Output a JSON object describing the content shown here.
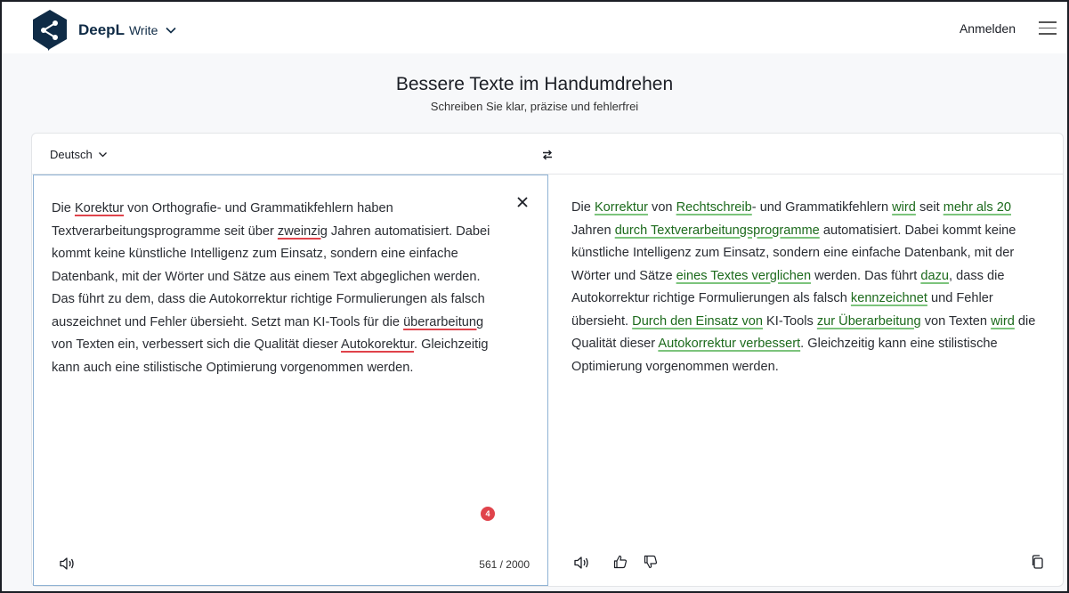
{
  "header": {
    "brand": "DeepL",
    "product": "Write",
    "login_label": "Anmelden",
    "icons": {
      "logo": "deepl-logo",
      "product_menu": "chevron-down-icon",
      "menu": "hamburger-menu-icon"
    }
  },
  "hero": {
    "title": "Bessere Texte im Handumdrehen",
    "subtitle": "Schreiben Sie klar, präzise und fehlerfrei"
  },
  "editor": {
    "language": "Deutsch",
    "input": {
      "segments": [
        {
          "t": "Die ",
          "s": "plain"
        },
        {
          "t": "Korektur",
          "s": "error"
        },
        {
          "t": " von Orthografie- und Grammatikfehlern haben Textverarbeitungsprogramme seit über ",
          "s": "plain"
        },
        {
          "t": "zweinzig",
          "s": "error"
        },
        {
          "t": " Jahren automatisiert. Dabei kommt keine künstliche Intelligenz zum Einsatz, sondern eine einfache Datenbank, mit der Wörter und Sätze aus einem Text abgeglichen werden. Das führt zu dem, dass die Autokorrektur richtige Formulierungen als falsch auszeichnet und Fehler übersieht. Setzt man KI-Tools für die ",
          "s": "plain"
        },
        {
          "t": "überarbeitung",
          "s": "error"
        },
        {
          "t": " von Texten ein, verbessert sich die Qualität dieser ",
          "s": "plain"
        },
        {
          "t": "Autokorektur",
          "s": "error"
        },
        {
          "t": ". Gleichzeitig kann auch eine stilistische Optimierung vorgenommen werden.",
          "s": "plain"
        }
      ],
      "error_count": "4",
      "char_counter": "561 / 2000"
    },
    "output": {
      "segments": [
        {
          "t": "Die ",
          "s": "plain"
        },
        {
          "t": "Korrektur",
          "s": "change"
        },
        {
          "t": " von ",
          "s": "plain"
        },
        {
          "t": "Rechtschreib",
          "s": "change"
        },
        {
          "t": "- und Grammatikfehlern ",
          "s": "plain"
        },
        {
          "t": "wird",
          "s": "change"
        },
        {
          "t": " seit ",
          "s": "plain"
        },
        {
          "t": "mehr als 20",
          "s": "change"
        },
        {
          "t": " Jahren ",
          "s": "plain"
        },
        {
          "t": "durch Textverarbeitungsprogramme",
          "s": "change"
        },
        {
          "t": " automatisiert. Dabei kommt keine künstliche Intelligenz zum Einsatz, sondern eine einfache Datenbank, mit der Wörter und Sätze ",
          "s": "plain"
        },
        {
          "t": "eines Textes verglichen",
          "s": "change"
        },
        {
          "t": " werden. Das führt ",
          "s": "plain"
        },
        {
          "t": "dazu",
          "s": "change"
        },
        {
          "t": ", dass die Autokorrektur richtige Formulierungen als falsch ",
          "s": "plain"
        },
        {
          "t": "kennzeichnet",
          "s": "change"
        },
        {
          "t": " und Fehler übersieht. ",
          "s": "plain"
        },
        {
          "t": "Durch den Einsatz von",
          "s": "change"
        },
        {
          "t": " KI-Tools ",
          "s": "plain"
        },
        {
          "t": "zur Überarbeitung",
          "s": "change"
        },
        {
          "t": " von Texten ",
          "s": "plain"
        },
        {
          "t": "wird",
          "s": "change"
        },
        {
          "t": " die Qualität dieser ",
          "s": "plain"
        },
        {
          "t": "Autokorrektur verbessert",
          "s": "change"
        },
        {
          "t": ". Gleichzeitig kann eine stilistische Optimierung vorgenommen werden.",
          "s": "plain"
        }
      ]
    },
    "icons": {
      "swap": "swap-arrows-icon",
      "close": "close-icon",
      "speaker": "speaker-icon",
      "thumbs_up": "thumbs-up-icon",
      "thumbs_down": "thumbs-down-icon",
      "copy": "copy-icon"
    }
  },
  "colors": {
    "error_underline": "#e0434b",
    "change_text": "#1c6a1c",
    "change_underline": "#7cc47c",
    "brand_dark": "#0f2b46",
    "focus_border": "#8fb2d4"
  }
}
